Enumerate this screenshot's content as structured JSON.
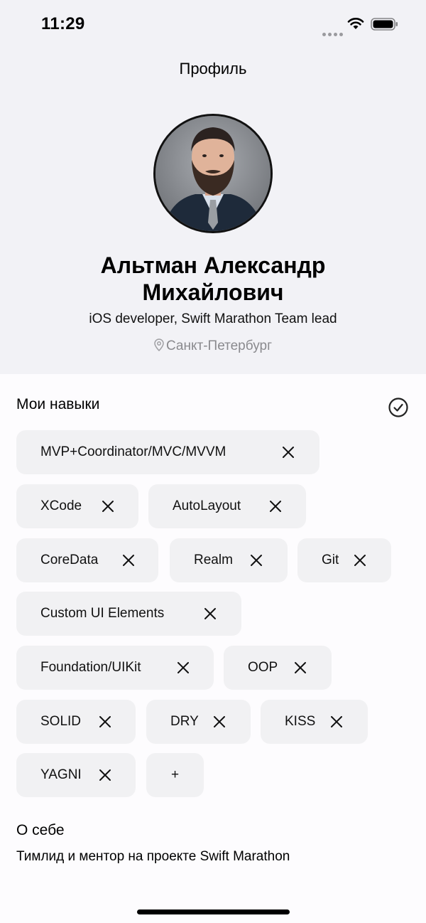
{
  "status_bar": {
    "time": "11:29"
  },
  "nav": {
    "title": "Профиль"
  },
  "profile": {
    "name": "Альтман Александр Михайлович",
    "job": "iOS developer, Swift Marathon Team lead",
    "location": "Санкт-Петербург"
  },
  "skills": {
    "title": "Мои навыки",
    "items": [
      "MVP+Coordinator/MVC/MVVM",
      "XCode",
      "AutoLayout",
      "CoreData",
      "Realm",
      "Git",
      "Custom UI Elements",
      "Foundation/UIKit",
      "OOP",
      "SOLID",
      "DRY",
      "KISS",
      "YAGNI"
    ],
    "add_label": "+"
  },
  "about": {
    "title": "О себе",
    "text": "Тимлид и ментор на проекте Swift Marathon"
  },
  "icons": {
    "edit": "checkmark-circle-icon",
    "remove": "close-icon",
    "location": "map-pin-icon"
  }
}
